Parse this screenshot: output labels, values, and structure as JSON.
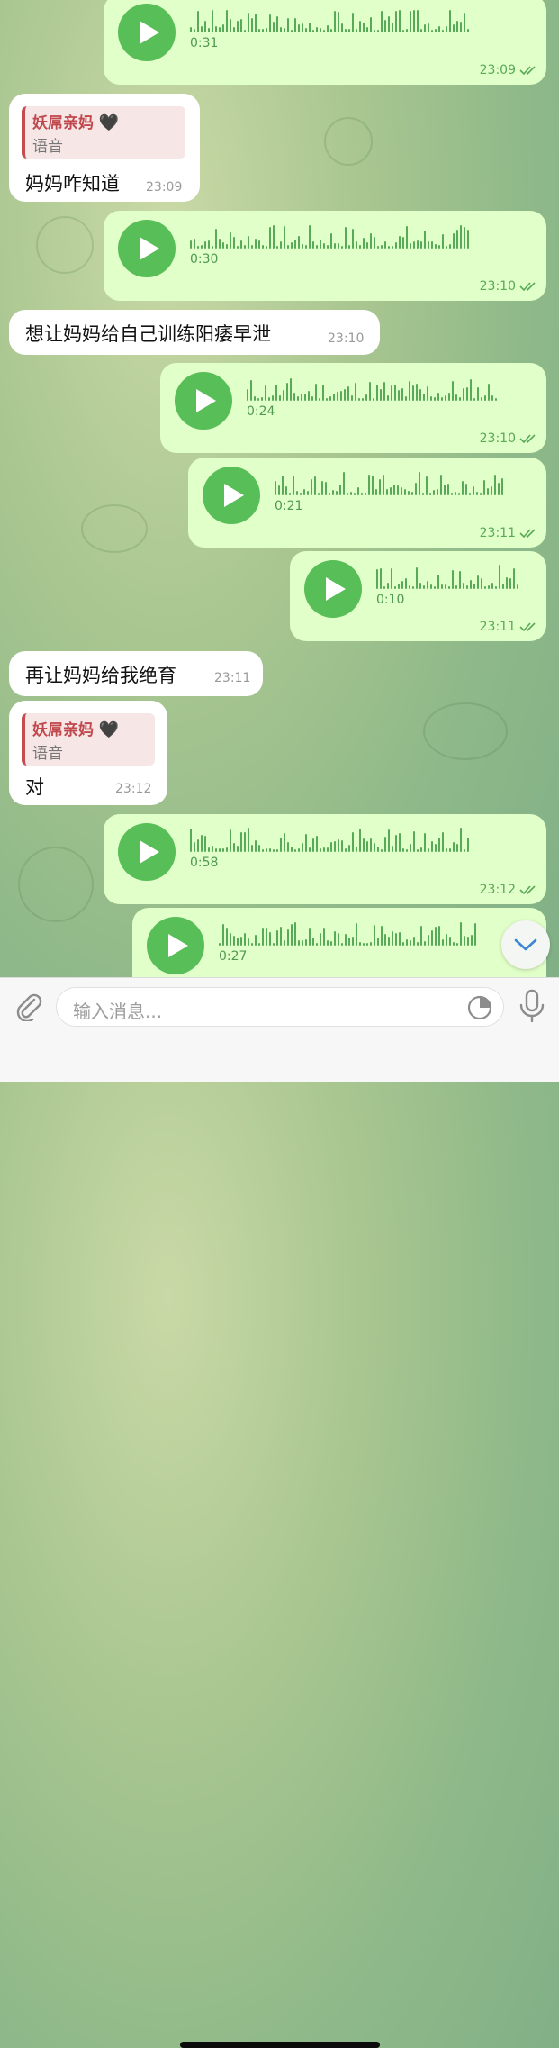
{
  "messages": [
    {
      "type": "voice",
      "dir": "out",
      "duration": "0:31",
      "time": "23:09"
    },
    {
      "type": "text",
      "dir": "in",
      "reply": {
        "name": "妖屌亲妈",
        "heart": "🖤",
        "sub": "语音"
      },
      "text": "妈妈咋知道",
      "time": "23:09"
    },
    {
      "type": "voice",
      "dir": "out",
      "duration": "0:30",
      "time": "23:10"
    },
    {
      "type": "text",
      "dir": "in",
      "text": "想让妈妈给自己训练阳痿早泄",
      "time": "23:10"
    },
    {
      "type": "voice",
      "dir": "out",
      "duration": "0:24",
      "time": "23:10"
    },
    {
      "type": "voice",
      "dir": "out",
      "duration": "0:21",
      "time": "23:11"
    },
    {
      "type": "voice",
      "dir": "out",
      "duration": "0:10",
      "time": "23:11"
    },
    {
      "type": "text",
      "dir": "in",
      "text": "再让妈妈给我绝育",
      "time": "23:11"
    },
    {
      "type": "text",
      "dir": "in",
      "reply": {
        "name": "妖屌亲妈",
        "heart": "🖤",
        "sub": "语音"
      },
      "text": "对",
      "time": "23:12"
    },
    {
      "type": "voice",
      "dir": "out",
      "duration": "0:58",
      "time": "23:12"
    },
    {
      "type": "voice",
      "dir": "out",
      "duration": "0:27",
      "time": ""
    }
  ],
  "input": {
    "placeholder": "输入消息..."
  },
  "icons": {
    "attach": "paperclip-icon",
    "sticker": "sticker-icon",
    "mic": "microphone-icon",
    "play": "play-icon",
    "read": "double-check-icon",
    "scroll": "chevron-down-icon"
  },
  "colors": {
    "outgoing": "#e1ffc8",
    "accent": "#58be58",
    "reply_name": "#c0474c"
  }
}
